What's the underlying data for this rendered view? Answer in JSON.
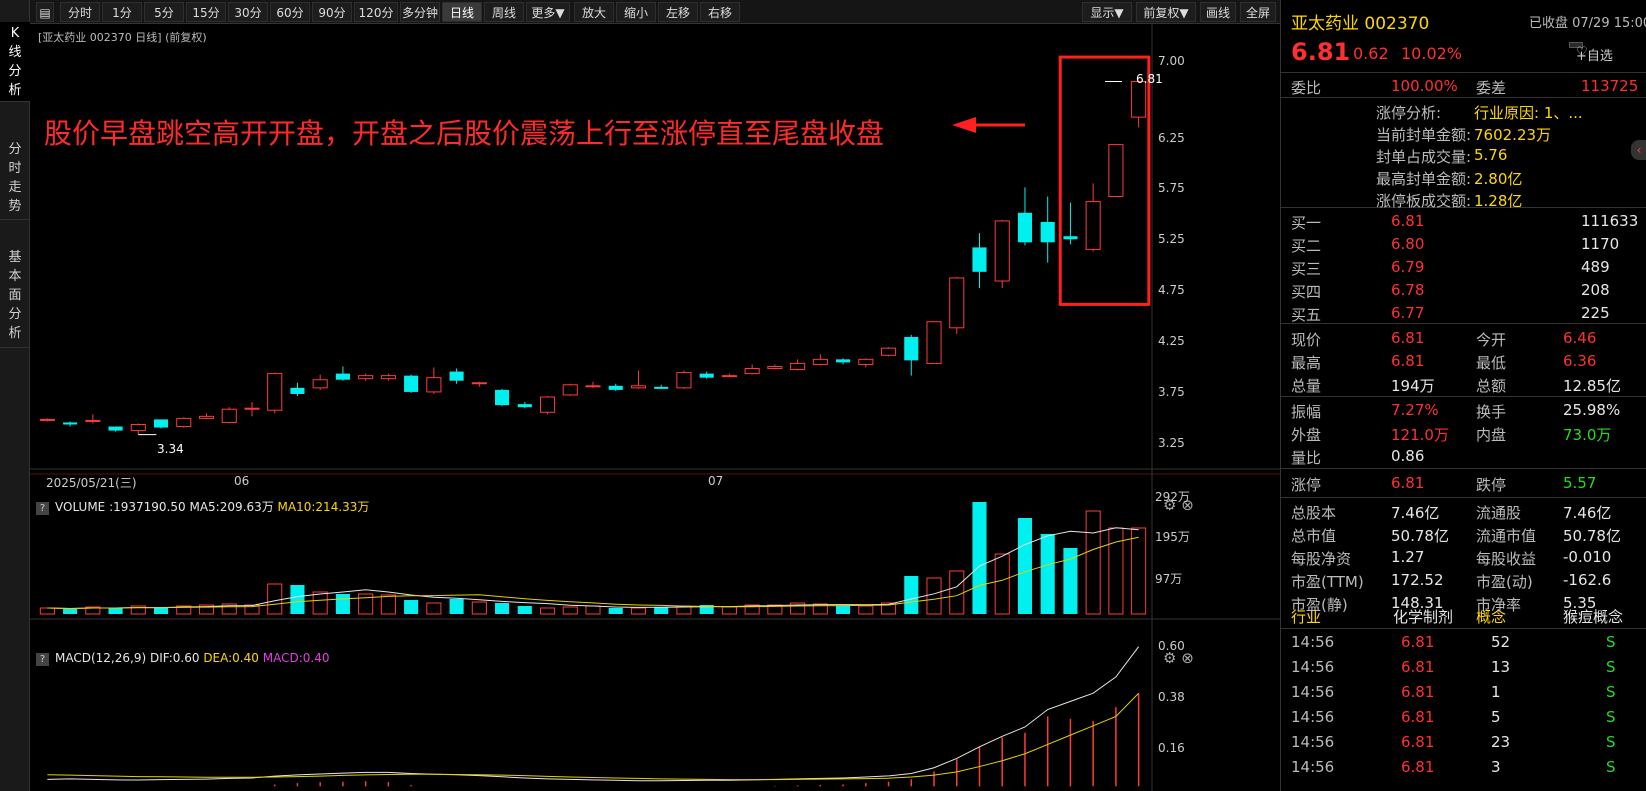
{
  "toolbar": {
    "items": [
      "分时",
      "1分",
      "5分",
      "15分",
      "30分",
      "60分",
      "90分",
      "120分",
      "多分钟",
      "日线",
      "周线",
      "更多▼",
      "放大",
      "缩小",
      "左移",
      "右移"
    ],
    "right_items": [
      "显示▼",
      "前复权▼",
      "画线",
      "全屏"
    ],
    "active": "日线"
  },
  "left_tabs": [
    "K线分析",
    "分时走势",
    "基本面分析"
  ],
  "chart": {
    "title": "[亚太药业 002370 日线]  (前复权)",
    "price_ticks": [
      "7.00",
      "6.25",
      "5.75",
      "5.25",
      "4.75",
      "4.25",
      "3.75",
      "3.25"
    ],
    "date_labels": [
      "2025/05/21(三)",
      "06",
      "07"
    ],
    "max_label": "6.81",
    "min_label": "3.34",
    "annotation": "股价早盘跳空高开开盘，开盘之后股价震荡上行至涨停直至尾盘收盘",
    "colors": {
      "up": "#ff3a3a",
      "down": "#00f0f0",
      "highlight": "#ff2020"
    }
  },
  "volume_panel": {
    "label": "VOLUME",
    "vol": ":1937190.50",
    "ma5": "MA5:209.63万",
    "ma10": "MA10:214.33万",
    "ticks": [
      "292万",
      "195万",
      "97万"
    ]
  },
  "macd_panel": {
    "label": "MACD(12,26,9)",
    "dif": "DIF:0.60",
    "dea": "DEA:0.40",
    "macd": "MACD:0.40",
    "ticks": [
      "0.60",
      "0.38",
      "0.16"
    ]
  },
  "quote": {
    "name": "亚太药业 002370",
    "status": "已收盘 07/29 15:00",
    "price": "6.81",
    "change": "0.62",
    "change_pct": "10.02%",
    "watch": "+自选",
    "ratio_label": "委比",
    "ratio": "100.00%",
    "diff_label": "委差",
    "diff": "113725",
    "limit_analysis": [
      {
        "label": "涨停分析:",
        "value": "行业原因: 1、..."
      },
      {
        "label": "当前封单金额:",
        "value": "7602.23万"
      },
      {
        "label": "封单占成交量:",
        "value": "5.76"
      },
      {
        "label": "最高封单金额:",
        "value": "2.80亿"
      },
      {
        "label": "涨停板成交额:",
        "value": "1.28亿"
      }
    ],
    "bids": [
      {
        "label": "买一",
        "price": "6.81",
        "vol": "111633"
      },
      {
        "label": "买二",
        "price": "6.80",
        "vol": "1170"
      },
      {
        "label": "买三",
        "price": "6.79",
        "vol": "489"
      },
      {
        "label": "买四",
        "price": "6.78",
        "vol": "208"
      },
      {
        "label": "买五",
        "price": "6.77",
        "vol": "225"
      }
    ],
    "stats1": [
      [
        "现价",
        "6.81",
        "red",
        "今开",
        "6.46",
        "red"
      ],
      [
        "最高",
        "6.81",
        "red",
        "最低",
        "6.36",
        "red"
      ],
      [
        "总量",
        "194万",
        "white",
        "总额",
        "12.85亿",
        "white"
      ]
    ],
    "stats2": [
      [
        "振幅",
        "7.27%",
        "red",
        "换手",
        "25.98%",
        "white"
      ],
      [
        "外盘",
        "121.0万",
        "red",
        "内盘",
        "73.0万",
        "green"
      ],
      [
        "量比",
        "0.86",
        "white",
        "",
        "",
        " "
      ]
    ],
    "stats3": [
      [
        "涨停",
        "6.81",
        "red",
        "跌停",
        "5.57",
        "green"
      ]
    ],
    "stats4": [
      [
        "总股本",
        "7.46亿",
        "white",
        "流通股",
        "7.46亿",
        "white"
      ],
      [
        "总市值",
        "50.78亿",
        "white",
        "流通市值",
        "50.78亿",
        "white"
      ],
      [
        "每股净资",
        "1.27",
        "white",
        "每股收益",
        "-0.010",
        "white"
      ],
      [
        "市盈(TTM)",
        "172.52",
        "white",
        "市盈(动)",
        "-162.6",
        "white"
      ],
      [
        "市盈(静)",
        "148.31",
        "white",
        "市净率",
        "5.35",
        "white"
      ]
    ],
    "industry": {
      "label": "行业",
      "value": "化学制剂",
      "concept_label": "概念",
      "concept": "猴痘概念"
    },
    "ticks": [
      {
        "time": "14:56",
        "price": "6.81",
        "vol": "52",
        "side": "S"
      },
      {
        "time": "14:56",
        "price": "6.81",
        "vol": "13",
        "side": "S"
      },
      {
        "time": "14:56",
        "price": "6.81",
        "vol": "1",
        "side": "S"
      },
      {
        "time": "14:56",
        "price": "6.81",
        "vol": "5",
        "side": "S"
      },
      {
        "time": "14:56",
        "price": "6.81",
        "vol": "23",
        "side": "S"
      },
      {
        "time": "14:56",
        "price": "6.81",
        "vol": "3",
        "side": "S"
      }
    ]
  },
  "chart_data": {
    "type": "candlestick",
    "y_range": [
      3.15,
      7.1
    ],
    "candles": [
      [
        3.48,
        3.49,
        3.47,
        3.5
      ],
      [
        3.46,
        3.44,
        3.42,
        3.47
      ],
      [
        3.47,
        3.48,
        3.45,
        3.54
      ],
      [
        3.42,
        3.38,
        3.37,
        3.42
      ],
      [
        3.38,
        3.44,
        3.34,
        3.45
      ],
      [
        3.49,
        3.41,
        3.4,
        3.49
      ],
      [
        3.42,
        3.5,
        3.41,
        3.51
      ],
      [
        3.5,
        3.52,
        3.49,
        3.55
      ],
      [
        3.46,
        3.59,
        3.45,
        3.61
      ],
      [
        3.59,
        3.6,
        3.52,
        3.66
      ],
      [
        3.58,
        3.94,
        3.55,
        3.95
      ],
      [
        3.8,
        3.74,
        3.72,
        3.85
      ],
      [
        3.8,
        3.88,
        3.78,
        3.93
      ],
      [
        3.94,
        3.88,
        3.87,
        4.01
      ],
      [
        3.89,
        3.92,
        3.87,
        3.94
      ],
      [
        3.89,
        3.92,
        3.87,
        3.94
      ],
      [
        3.92,
        3.76,
        3.75,
        3.93
      ],
      [
        3.76,
        3.9,
        3.74,
        4.0
      ],
      [
        3.96,
        3.87,
        3.84,
        3.99
      ],
      [
        3.85,
        3.85,
        3.81,
        3.86
      ],
      [
        3.78,
        3.63,
        3.62,
        3.79
      ],
      [
        3.64,
        3.61,
        3.6,
        3.66
      ],
      [
        3.56,
        3.71,
        3.54,
        3.72
      ],
      [
        3.73,
        3.83,
        3.72,
        3.84
      ],
      [
        3.82,
        3.82,
        3.8,
        3.86
      ],
      [
        3.82,
        3.78,
        3.77,
        3.84
      ],
      [
        3.8,
        3.82,
        3.79,
        3.97
      ],
      [
        3.81,
        3.79,
        3.79,
        3.83
      ],
      [
        3.8,
        3.95,
        3.79,
        3.97
      ],
      [
        3.94,
        3.9,
        3.89,
        3.96
      ],
      [
        3.91,
        3.92,
        3.91,
        3.94
      ],
      [
        3.94,
        3.99,
        3.93,
        4.03
      ],
      [
        3.99,
        4.01,
        3.98,
        4.03
      ],
      [
        3.98,
        4.04,
        3.97,
        4.08
      ],
      [
        4.03,
        4.08,
        4.02,
        4.13
      ],
      [
        4.08,
        4.05,
        4.03,
        4.09
      ],
      [
        4.03,
        4.08,
        4.0,
        4.09
      ],
      [
        4.12,
        4.19,
        4.11,
        4.2
      ],
      [
        4.3,
        4.07,
        3.92,
        4.32
      ],
      [
        4.04,
        4.45,
        4.04,
        4.45
      ],
      [
        4.39,
        4.88,
        4.33,
        4.89
      ],
      [
        5.18,
        4.94,
        4.78,
        5.32
      ],
      [
        4.85,
        5.44,
        4.78,
        5.45
      ],
      [
        5.52,
        5.23,
        5.2,
        5.77
      ],
      [
        5.43,
        5.23,
        5.03,
        5.68
      ],
      [
        5.29,
        5.26,
        5.21,
        5.62
      ],
      [
        5.16,
        5.63,
        5.14,
        5.81
      ],
      [
        5.68,
        6.19,
        5.68,
        6.19
      ],
      [
        6.46,
        6.81,
        6.36,
        6.81
      ]
    ],
    "volume": [
      30,
      25,
      35,
      30,
      40,
      30,
      40,
      45,
      50,
      45,
      150,
      145,
      110,
      100,
      100,
      95,
      70,
      55,
      75,
      60,
      55,
      40,
      30,
      35,
      40,
      30,
      30,
      35,
      40,
      45,
      35,
      45,
      45,
      55,
      50,
      40,
      40,
      55,
      190,
      180,
      215,
      560,
      300,
      480,
      400,
      330,
      515,
      430,
      430
    ],
    "macd_dif": [
      0.03,
      0.032,
      0.03,
      0.028,
      0.027,
      0.029,
      0.03,
      0.031,
      0.034,
      0.036,
      0.044,
      0.049,
      0.053,
      0.057,
      0.06,
      0.06,
      0.055,
      0.052,
      0.05,
      0.046,
      0.041,
      0.036,
      0.032,
      0.03,
      0.028,
      0.026,
      0.024,
      0.024,
      0.025,
      0.026,
      0.026,
      0.028,
      0.03,
      0.032,
      0.034,
      0.036,
      0.04,
      0.045,
      0.055,
      0.08,
      0.12,
      0.17,
      0.215,
      0.255,
      0.33,
      0.365,
      0.4,
      0.47,
      0.6
    ],
    "macd_dea": [
      0.05,
      0.048,
      0.046,
      0.044,
      0.042,
      0.041,
      0.04,
      0.039,
      0.039,
      0.039,
      0.04,
      0.042,
      0.044,
      0.047,
      0.049,
      0.051,
      0.052,
      0.052,
      0.051,
      0.05,
      0.048,
      0.046,
      0.043,
      0.04,
      0.038,
      0.036,
      0.034,
      0.032,
      0.031,
      0.03,
      0.029,
      0.029,
      0.029,
      0.03,
      0.031,
      0.032,
      0.033,
      0.035,
      0.04,
      0.048,
      0.062,
      0.085,
      0.11,
      0.14,
      0.18,
      0.22,
      0.26,
      0.3,
      0.4
    ]
  }
}
